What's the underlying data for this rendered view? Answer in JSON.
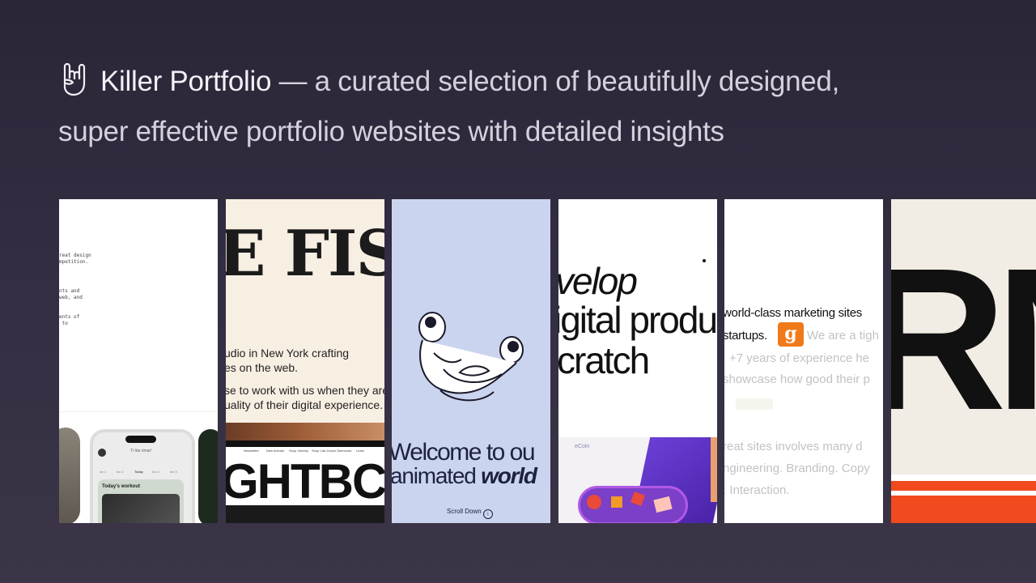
{
  "header": {
    "brand": "Killer Portfolio",
    "tagline": " — a curated selection of beautifully designed,",
    "tagline_line2": "super effective portfolio websites with detailed insights",
    "logo_icon": "rock-hand-icon"
  },
  "cards": [
    {
      "lines": [
        "reat design",
        "mpetition.",
        "nts and",
        "web, and",
        "ents of",
        " to"
      ],
      "phone_header": "Today's workout",
      "phone_small": "Ti Ida rimar!",
      "phone_days": [
        "Ian 1",
        "Ian 2",
        "Today",
        "Ian 4",
        "Ian 5"
      ]
    },
    {
      "big_text": "E FIS",
      "para1": [
        "udio in New York crafting",
        "es on the web."
      ],
      "para2": [
        "se to work with us when they are",
        "uality of their digital experience."
      ],
      "nav": [
        "Newsletter",
        "New Arrivals",
        "Shop Jewelry",
        "Shop Lab-Grown Diamonds",
        "Learn"
      ],
      "big_text2": "GHTBC"
    },
    {
      "welcome": "Welcome to ou",
      "animated": "animated ",
      "world": "world",
      "scroll": "Scroll Down"
    },
    {
      "lines": [
        "velop",
        "igital produ",
        "cratch"
      ],
      "coin_label": "eCoin"
    },
    {
      "line1": "world-class marketing sites",
      "startups": "startups.",
      "g_badge": "g",
      "we_are": "We are a tigh",
      "years": "+7 years of experience he",
      "showcase": "showcase how good their p",
      "great": "reat sites involves many d",
      "engineering": "ngineering. Branding. Copy",
      "interaction": ". Interaction."
    },
    {
      "big": "RN"
    }
  ]
}
